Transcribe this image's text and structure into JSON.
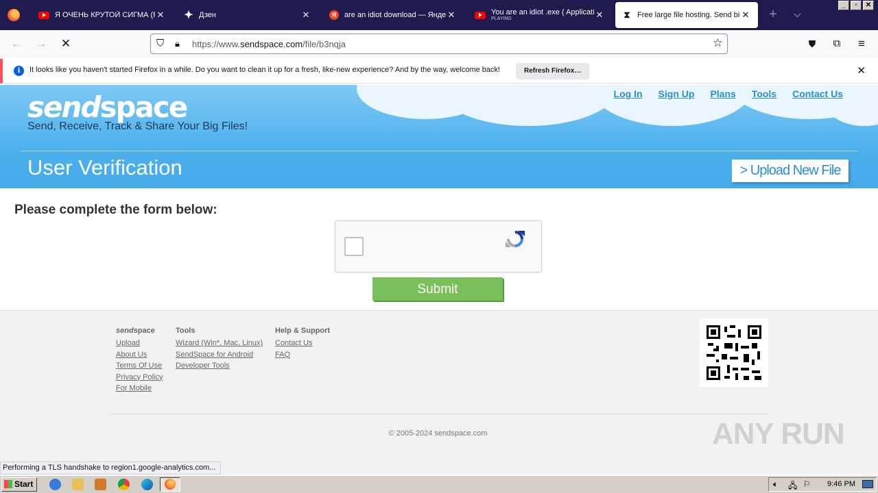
{
  "browser": {
    "tabs": [
      {
        "title": "Я ОЧЕНЬ КРУТОЙ СИГМА (PHONK",
        "icon": "youtube-icon",
        "sub": ""
      },
      {
        "title": "Дзен",
        "icon": "dzen-icon",
        "sub": ""
      },
      {
        "title": "are an idiot download — Яндекс",
        "icon": "yandex-icon",
        "sub": ""
      },
      {
        "title": "You are an idiot .exe ( Application",
        "icon": "youtube-icon",
        "sub": "PLAYING"
      },
      {
        "title": "Free large file hosting. Send big",
        "icon": "hourglass-icon",
        "sub": ""
      }
    ],
    "url_prefix": "https://www.",
    "url_domain": "sendspace.com",
    "url_path": "/file/b3nqja"
  },
  "notification": {
    "message": "It looks like you haven't started Firefox in a while. Do you want to clean it up for a fresh, like-new experience? And by the way, welcome back!",
    "button": "Refresh Firefox…"
  },
  "site": {
    "logo_a": "send",
    "logo_b": "space",
    "tagline": "Send, Receive, Track & Share Your Big Files!",
    "nav": [
      "Log In",
      "Sign Up",
      "Plans",
      "Tools",
      "Contact Us"
    ],
    "page_title": "User Verification",
    "upload_button": "> Upload New File"
  },
  "main": {
    "heading": "Please complete the form below:",
    "submit": "Submit"
  },
  "footer": {
    "col1": {
      "head_a": "send",
      "head_b": "space",
      "links": [
        "Upload",
        "About Us",
        "Terms Of Use",
        "Privacy Policy",
        "For Mobile"
      ]
    },
    "col2": {
      "head": "Tools",
      "links": [
        "Wizard (Win*, Mac, Linux)",
        "SendSpace for Android",
        "Developer Tools"
      ]
    },
    "col3": {
      "head": "Help & Support",
      "links": [
        "Contact Us",
        "FAQ"
      ]
    },
    "copyright": "© 2005-2024 sendspace.com",
    "watermark": "ANY RUN"
  },
  "status": "Performing a TLS handshake to region1.google-analytics.com...",
  "taskbar": {
    "start": "Start",
    "clock": "9:46 PM"
  }
}
